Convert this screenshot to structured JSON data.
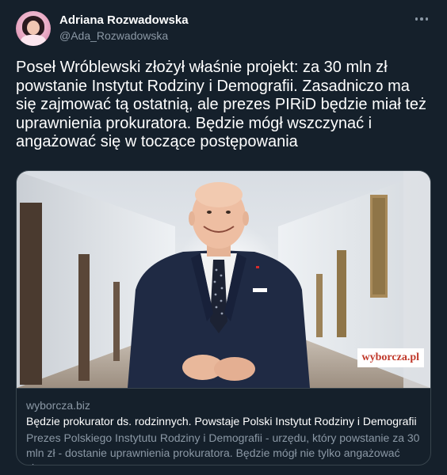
{
  "author": {
    "name": "Adriana Rozwadowska",
    "handle": "@Ada_Rozwadowska"
  },
  "tweet": {
    "text": "Poseł Wróblewski złożył właśnie projekt: za 30 mln zł powstanie Instytut Rodziny i Demografii. Zasadniczo ma się zajmować tą ostatnią, ale prezes PIRiD będzie miał też uprawnienia prokuratora. Będzie mógł wszczynać i angażować się w toczące postępowania"
  },
  "card": {
    "domain": "wyborcza.biz",
    "title": "Będzie prokurator ds. rodzinnych. Powstaje Polski Instytut Rodziny i Demografii",
    "description": "Prezes Polskiego Instytutu Rodziny i Demografii - urzędu, który powstanie za 30 mln zł - dostanie uprawnienia prokuratora. Będzie mógł nie tylko angażować się…",
    "watermark": "wyborcza.pl"
  },
  "icons": {
    "more": "more-options-icon"
  },
  "colors": {
    "background": "#15202b",
    "text": "#ffffff",
    "secondary_text": "#8b98a5",
    "border": "#38444d"
  }
}
